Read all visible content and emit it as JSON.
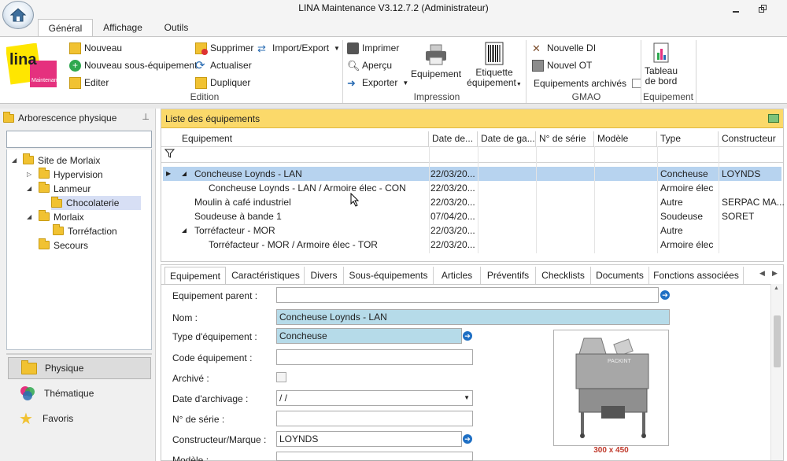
{
  "window": {
    "title": "LINA Maintenance  V3.12.7.2  (Administrateur)"
  },
  "ribbon_tabs": [
    "Général",
    "Affichage",
    "Outils"
  ],
  "ribbon": {
    "logo_text": "lina",
    "logo_sub": "Maintenance",
    "edition": {
      "nouveau": "Nouveau",
      "nouveau_sous": "Nouveau sous-équipement",
      "editer": "Editer",
      "supprimer": "Supprimer",
      "actualiser": "Actualiser",
      "dupliquer": "Dupliquer",
      "import_export": "Import/Export",
      "group": "Edition"
    },
    "impression": {
      "imprimer": "Imprimer",
      "apercu": "Aperçu",
      "exporter": "Exporter",
      "equipement": "Equipement",
      "etiquette1": "Etiquette",
      "etiquette2": "équipement",
      "group": "Impression"
    },
    "gmao": {
      "nouvelle_di": "Nouvelle DI",
      "nouvel_ot": "Nouvel OT",
      "archives": "Equipements archivés",
      "group": "GMAO"
    },
    "equipement": {
      "tableau1": "Tableau",
      "tableau2": "de bord",
      "group": "Equipement"
    }
  },
  "left_pane": {
    "header": "Arborescence physique",
    "tree": [
      {
        "label": "Site de Morlaix"
      },
      {
        "label": "Hypervision"
      },
      {
        "label": "Lanmeur"
      },
      {
        "label": "Chocolaterie"
      },
      {
        "label": "Morlaix"
      },
      {
        "label": "Torréfaction"
      },
      {
        "label": "Secours"
      }
    ],
    "nav": [
      "Physique",
      "Thématique",
      "Favoris"
    ]
  },
  "grid": {
    "title": "Liste des équipements",
    "columns": [
      "Equipement",
      "Date de...",
      "Date de ga...",
      "N° de série",
      "Modèle",
      "Type",
      "Constructeur"
    ],
    "rows": [
      {
        "equip": "Concheuse Loynds - LAN",
        "date": "22/03/20...",
        "type": "Concheuse",
        "constructeur": "LOYNDS"
      },
      {
        "equip": "Concheuse Loynds - LAN / Armoire élec - CON",
        "date": "22/03/20...",
        "type": "Armoire élec",
        "constructeur": ""
      },
      {
        "equip": "Moulin à café industriel",
        "date": "22/03/20...",
        "type": "Autre",
        "constructeur": "SERPAC MA..."
      },
      {
        "equip": "Soudeuse à bande 1",
        "date": "07/04/20...",
        "type": "Soudeuse",
        "constructeur": "SORET"
      },
      {
        "equip": "Torréfacteur - MOR",
        "date": "22/03/20...",
        "type": "Autre",
        "constructeur": ""
      },
      {
        "equip": "Torréfacteur - MOR / Armoire élec - TOR",
        "date": "22/03/20...",
        "type": "Armoire élec",
        "constructeur": ""
      }
    ]
  },
  "detail": {
    "tabs": [
      "Equipement",
      "Caractéristiques",
      "Divers",
      "Sous-équipements",
      "Articles",
      "Préventifs",
      "Checklists",
      "Documents",
      "Fonctions associées"
    ],
    "labels": {
      "parent": "Equipement parent :",
      "nom": "Nom :",
      "type": "Type d'équipement :",
      "code": "Code équipement :",
      "archive": "Archivé :",
      "date_archivage": "Date d'archivage :",
      "serie": "N° de série :",
      "constructeur": "Constructeur/Marque :",
      "modele": "Modèle :"
    },
    "values": {
      "nom": "Concheuse Loynds - LAN",
      "type": "Concheuse",
      "date_archivage": "   /    /",
      "constructeur": "LOYNDS"
    },
    "image_caption": "300 x 450",
    "image_brand": "PACKINT"
  },
  "colors": {
    "accent": "#fbd96a",
    "selection": "#b7d3ef",
    "field_highlight": "#b6dbe9",
    "go_button": "#1e6fc4"
  }
}
